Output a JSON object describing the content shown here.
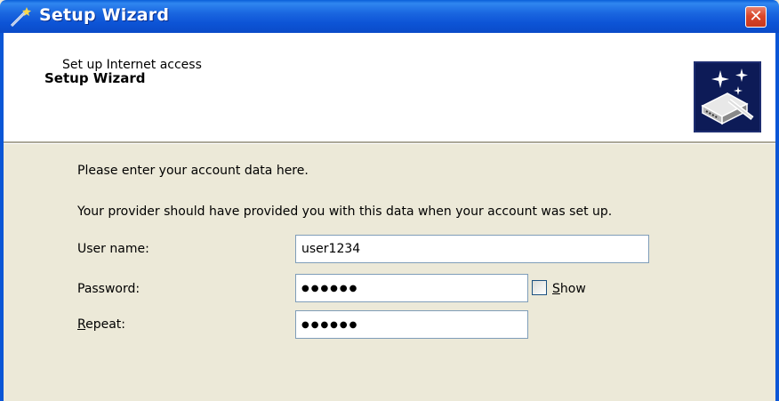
{
  "window": {
    "title": "Setup Wizard",
    "close_glyph": "✕",
    "icon": "wizard-wand-icon"
  },
  "header": {
    "title": "Setup Wizard",
    "subtitle": "Set up Internet access",
    "icon": "wizard-network-icon"
  },
  "body": {
    "intro_line1": "Please enter your account data here.",
    "intro_line2": "Your provider should have provided you with this data when your account was set up.",
    "username": {
      "label": "User name:",
      "value": "user1234"
    },
    "password": {
      "label": "Password:",
      "value": "●●●●●●"
    },
    "repeat": {
      "label_accel": "R",
      "label_rest": "epeat:",
      "value": "●●●●●●"
    },
    "show": {
      "label_accel": "S",
      "label_rest": "how",
      "checked": false
    }
  },
  "colors": {
    "titlebar": "#0a5fd8",
    "frame": "#0b56d6",
    "dialog_bg": "#ece9d8",
    "field_border": "#7f9db9",
    "close_red": "#d9472a"
  }
}
